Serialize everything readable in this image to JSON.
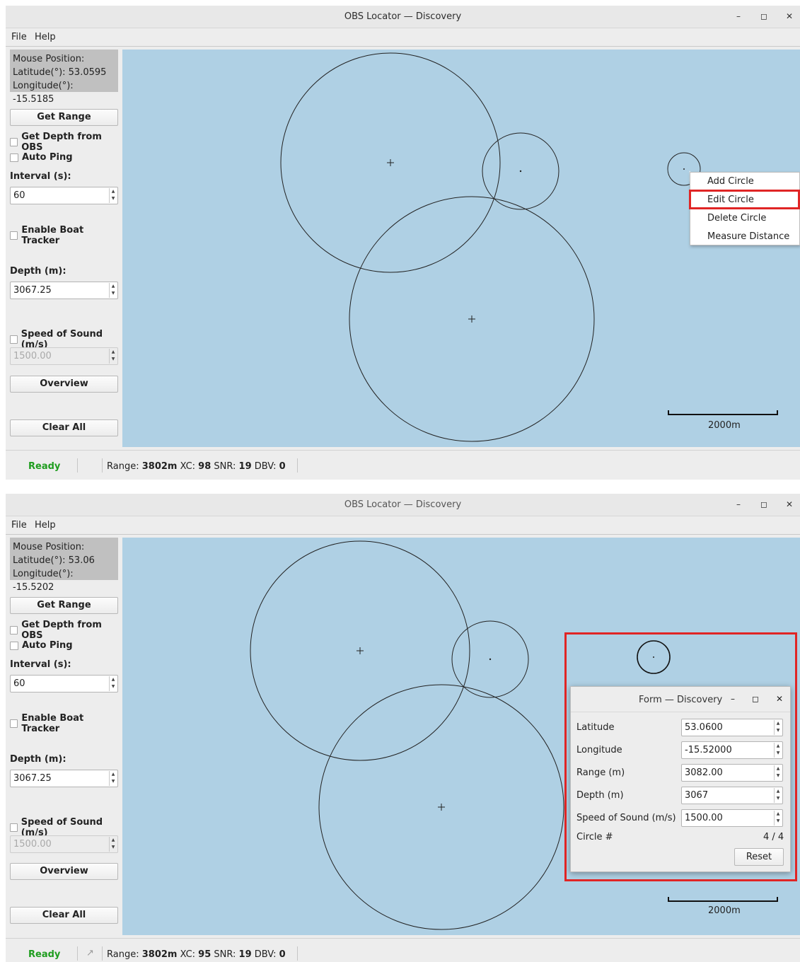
{
  "window1": {
    "title": "OBS Locator — Discovery",
    "menu": [
      "File",
      "Help"
    ],
    "mouse": {
      "header": "Mouse Position:",
      "lat": "Latitude(°): 53.0595",
      "lon": "Longitude(°): -15.5185"
    },
    "interval": "60",
    "depth": "3067.25",
    "sound_speed": "1500.00",
    "scale_label": "2000m",
    "status": {
      "ready": "Ready",
      "range_label": "Range:",
      "range": "3802m",
      "xc_label": "XC:",
      "xc": "98",
      "snr_label": "SNR:",
      "snr": "19",
      "dbv_label": "DBV:",
      "dbv": "0"
    },
    "context_menu": [
      "Add Circle",
      "Edit Circle",
      "Delete Circle",
      "Measure Distance"
    ]
  },
  "window2": {
    "title": "OBS Locator — Discovery",
    "menu": [
      "File",
      "Help"
    ],
    "mouse": {
      "header": "Mouse Position:",
      "lat": "Latitude(°): 53.06",
      "lon": "Longitude(°): -15.5202"
    },
    "interval": "60",
    "depth": "3067.25",
    "sound_speed": "1500.00",
    "scale_label": "2000m",
    "status": {
      "ready": "Ready",
      "range_label": "Range:",
      "range": "3802m",
      "xc_label": "XC:",
      "xc": "95",
      "snr_label": "SNR:",
      "snr": "19",
      "dbv_label": "DBV:",
      "dbv": "0"
    },
    "form": {
      "title": "Form — Discovery",
      "latitude_label": "Latitude",
      "latitude": "53.0600",
      "longitude_label": "Longitude",
      "longitude": "-15.52000",
      "range_label": "Range (m)",
      "range": "3082.00",
      "depth_label": "Depth (m)",
      "depth": "3067",
      "sos_label": "Speed of Sound (m/s)",
      "sos": "1500.00",
      "circle_label": "Circle #",
      "circle": "4 / 4",
      "reset": "Reset"
    }
  },
  "sidebar": {
    "get_range": "Get Range",
    "get_depth": "Get Depth from OBS",
    "auto_ping": "Auto Ping",
    "interval_label": "Interval (s):",
    "boat_tracker": "Enable Boat Tracker",
    "depth_label": "Depth (m):",
    "sound_label": "Speed of Sound (m/s)",
    "overview": "Overview",
    "clear_all": "Clear All"
  },
  "window_buttons": {
    "minimize": "–",
    "maximize": "◻",
    "close": "✕"
  },
  "colors": {
    "map_bg": "#afd0e4",
    "highlight": "#e02525",
    "ready": "#1f9d1f"
  }
}
